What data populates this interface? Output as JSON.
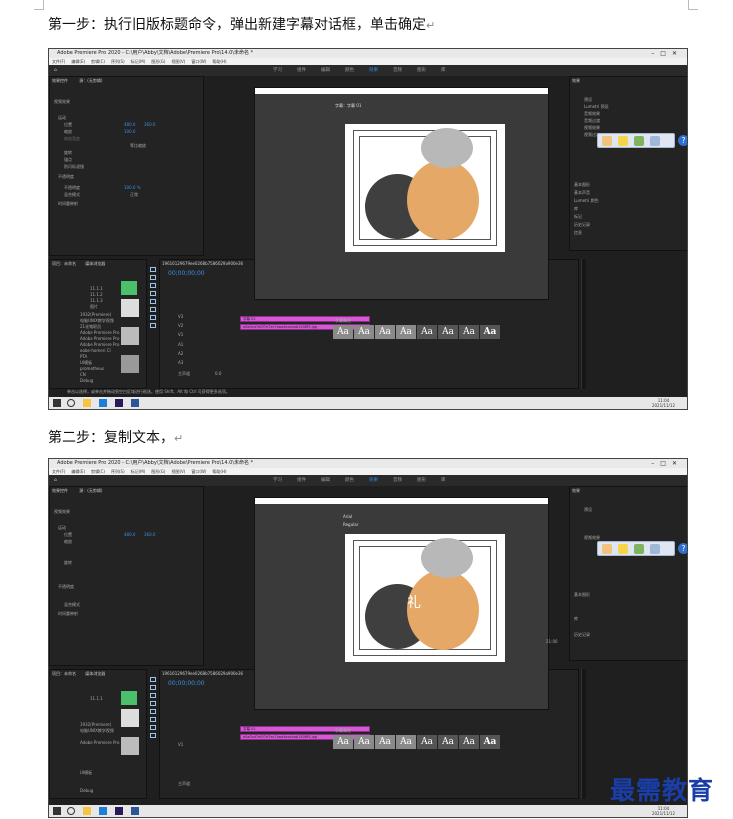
{
  "step1": {
    "text": "第一步：执行旧版标题命令，弹出新建字幕对话框，单击确定",
    "mark": "↵"
  },
  "step2": {
    "text": "第二步：复制文本，",
    "mark": "↵"
  },
  "screenshot": {
    "window_title": "Adobe Premiere Pro 2020 - C:\\用户\\Abby\\文档\\Adobe\\Premiere Pro\\14.0\\未命名 *",
    "menu": [
      "文件(F)",
      "编辑(E)",
      "剪辑(C)",
      "序列(S)",
      "标记(M)",
      "图形(G)",
      "视图(V)",
      "窗口(W)",
      "帮助(H)"
    ],
    "workspaces": [
      "学习",
      "组件",
      "编辑",
      "颜色",
      "效果",
      "音频",
      "图形",
      "库"
    ],
    "active_workspace": "效果",
    "right_panel_title": "效果",
    "right_panel_items": [
      "预设",
      "Lumetri 预设",
      "音频效果",
      "音频过渡",
      "视频效果",
      "视频过渡"
    ],
    "right_panel_sub": [
      "基本图形",
      "基本声音",
      "Lumetri 颜色",
      "库",
      "标记",
      "历史记录",
      "信息"
    ],
    "left_panel_tabs": [
      "效果控件",
      "源：(无剪辑)"
    ],
    "effect_rows": [
      "视频效果",
      "运动",
      "位置",
      "缩放",
      "缩放宽度",
      "等比缩放",
      "旋转",
      "锚点",
      "防闪烁滤镜",
      "不透明度",
      "不透明度",
      "混合模式",
      "时间重映射"
    ],
    "effect_values": [
      "480.0",
      "360.0",
      "100.0",
      "100.0",
      "0.0",
      "480.0",
      "0.00",
      "100.0 %",
      "正常"
    ],
    "dialog_title": "字幕：字幕 01",
    "dialog_tabs": [
      "字幕属性"
    ],
    "font_name": "Arial",
    "font_style": "Regular",
    "title_text_step2": "礼",
    "style_labels": [
      "Aa",
      "Aa",
      "Aa",
      "Aa",
      "Aa",
      "Aa",
      "Aa",
      "Aa"
    ],
    "project_tabs": [
      "项目：未命名",
      "媒体浏览器"
    ],
    "project_items": [
      "11.1.1",
      "11.1.2",
      "11.1.3",
      "图片",
      "1932(Premiere)",
      "电脑UNIX教学视频",
      "21化笔职员",
      "Adobe Premiere Pro",
      "Adobe Premiere Pro",
      "Adobe Premiere Pro",
      "oobe-homeri Cl",
      "PTA",
      "UI模板",
      "prometheus",
      "CN",
      "Debug"
    ],
    "sequence_tab": "19616129679ee0268b7586029a900e36",
    "timecode": "00;00;00;00",
    "track_names": [
      "V3",
      "V2",
      "V1",
      "A1",
      "A2",
      "A3",
      "主声道"
    ],
    "clip_title": "字幕 01",
    "clip_image": "e0a0cd7e0f7e7ec7aaa4eacbab1408f5.jpg",
    "master_level": "0.0",
    "meter_values": [
      "0",
      "-6",
      "-12",
      "-18",
      "-24",
      "-30",
      "-36",
      "-42",
      "-48",
      "-54",
      "dB"
    ],
    "taskbar_time": "11:04",
    "taskbar_date": "2021/11/12",
    "status_text": "单击以选择，或单击并拖动到空白区域进行框选。使用 Shift、Alt 和 Ctrl 可获得更多选项。",
    "extra_value": "21:00"
  },
  "watermark": "最需教育",
  "colors": {
    "accent": "#2d8ceb",
    "clip": "#d35ad3",
    "watermark": "#1a3ea8",
    "panel": "#232323"
  }
}
